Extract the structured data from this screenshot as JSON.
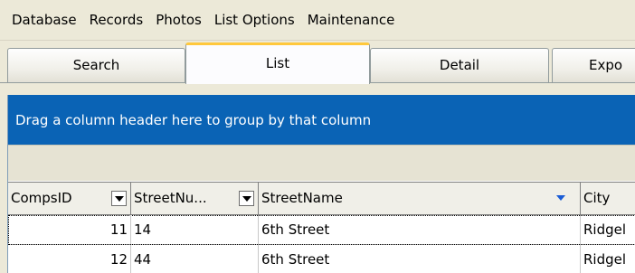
{
  "menu": [
    "Database",
    "Records",
    "Photos",
    "List Options",
    "Maintenance"
  ],
  "tabs": [
    {
      "label": "Search",
      "active": false
    },
    {
      "label": "List",
      "active": true
    },
    {
      "label": "Detail",
      "active": false
    },
    {
      "label": "Expo",
      "active": false
    }
  ],
  "grid": {
    "group_hint": "Drag a column header here to group by that column",
    "columns": [
      "CompsID",
      "StreetNu...",
      "StreetName",
      "City"
    ],
    "rows": [
      [
        "11",
        "14",
        "6th Street",
        "Ridgel"
      ],
      [
        "12",
        "44",
        "6th Street",
        "Ridgel"
      ]
    ]
  },
  "colors": {
    "group_panel": "#0a63b5",
    "active_tab_accent": "#ffc83c",
    "sort_arrow": "#1a5cd6"
  }
}
